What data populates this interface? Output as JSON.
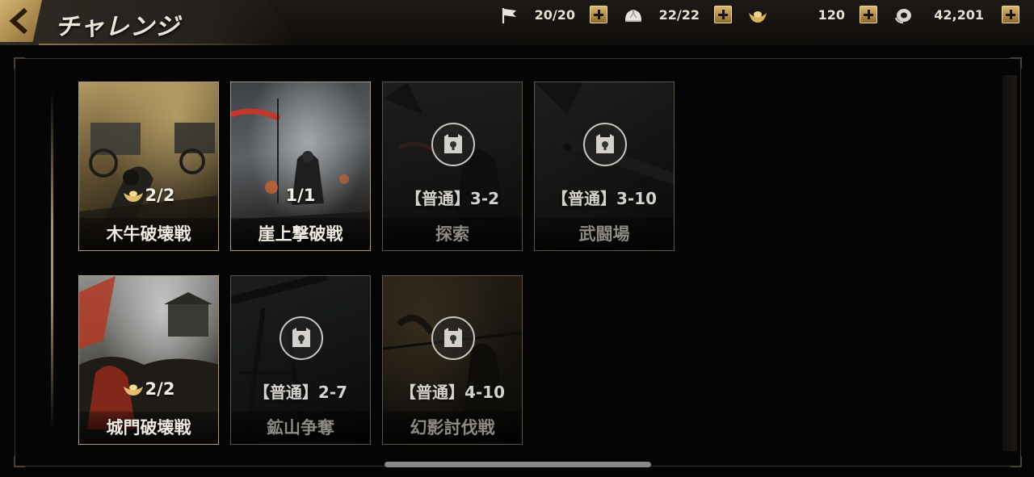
{
  "header": {
    "title": "チャレンジ",
    "resources": [
      {
        "icon": "flag-icon",
        "value": "20/20"
      },
      {
        "icon": "steamed-bun-icon",
        "value": "22/22"
      },
      {
        "icon": "gold-ingot-icon",
        "value": "120"
      },
      {
        "icon": "silver-coin-icon",
        "value": "42,201"
      }
    ]
  },
  "colors": {
    "accent_gold": "#c9a45e",
    "panel_border": "#3a322a",
    "text_light": "#ece6d8"
  },
  "challenges": [
    {
      "name": "木牛破壊戦",
      "status": "unlocked",
      "count": "2/2",
      "count_icon": "gold-ingot-icon"
    },
    {
      "name": "崖上撃破戦",
      "status": "unlocked",
      "count": "1/1"
    },
    {
      "name": "探索",
      "status": "locked",
      "requirement": "【普通】3-2"
    },
    {
      "name": "武闘場",
      "status": "locked",
      "requirement": "【普通】3-10"
    },
    {
      "name": "城門破壊戦",
      "status": "unlocked",
      "count": "2/2",
      "count_icon": "gold-ingot-icon"
    },
    {
      "name": "鉱山争奪",
      "status": "locked",
      "requirement": "【普通】2-7"
    },
    {
      "name": "幻影討伐戦",
      "status": "locked",
      "requirement": "【普通】4-10"
    }
  ]
}
